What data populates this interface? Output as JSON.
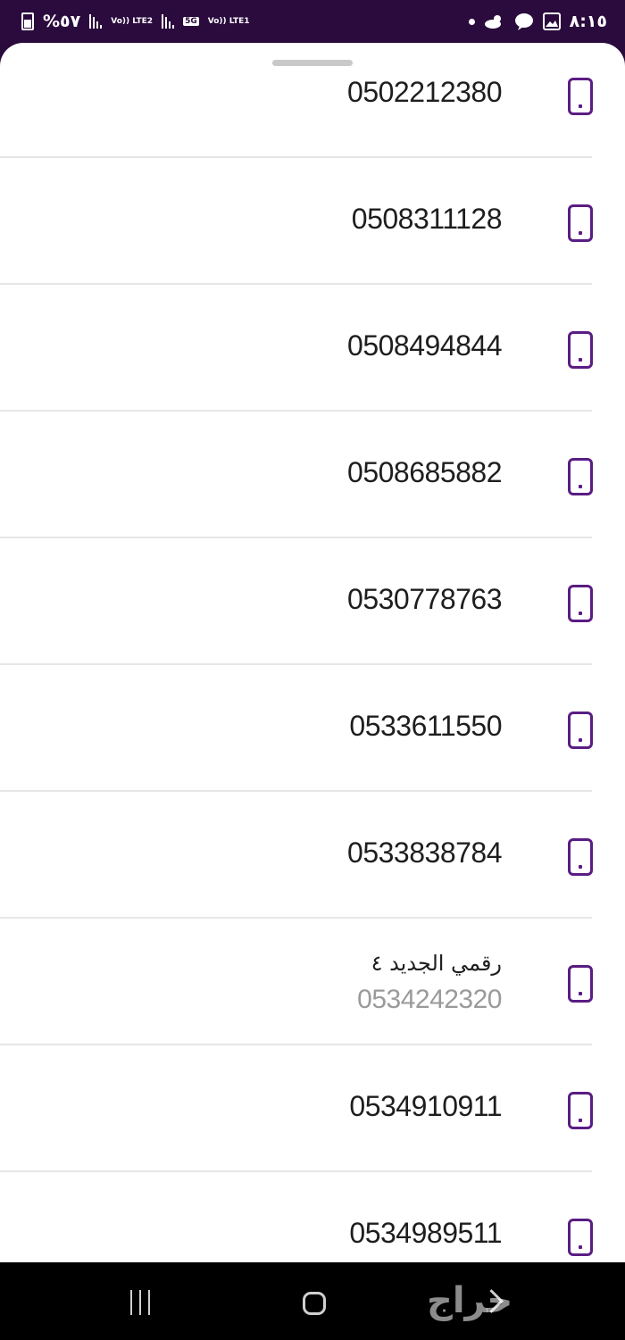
{
  "status_bar": {
    "battery_percent": "%٥٧",
    "sim2_tag": "Vo)) LTE2",
    "network_5g": "5G",
    "sim1_tag": "Vo)) LTE1",
    "time": "٨:١٥"
  },
  "contacts": [
    {
      "number": "0502212380"
    },
    {
      "number": "0508311128"
    },
    {
      "number": "0508494844"
    },
    {
      "number": "0508685882"
    },
    {
      "number": "0530778763"
    },
    {
      "number": "0533611550"
    },
    {
      "number": "0533838784"
    },
    {
      "label": "رقمي الجديد ٤",
      "number": "0534242320"
    },
    {
      "number": "0534910911"
    },
    {
      "number": "0534989511"
    }
  ],
  "watermark": "حراج",
  "colors": {
    "accent": "#5a1d83",
    "statusbar": "#2b0b3d"
  }
}
